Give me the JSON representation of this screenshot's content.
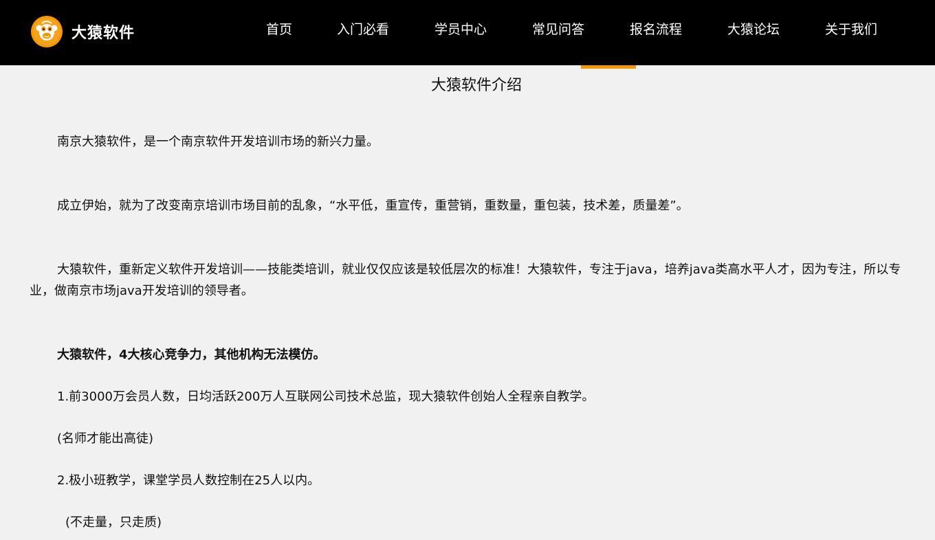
{
  "header": {
    "brand": "大猿软件",
    "logo_icon": "monkey-logo-icon",
    "accent_color": "#f39800",
    "nav": [
      {
        "label": "首页",
        "active": false
      },
      {
        "label": "入门必看",
        "active": false
      },
      {
        "label": "学员中心",
        "active": false
      },
      {
        "label": "常见问答",
        "active": false
      },
      {
        "label": "报名流程",
        "active": false
      },
      {
        "label": "大猿论坛",
        "active": false
      },
      {
        "label": "关于我们",
        "active": true
      }
    ]
  },
  "main": {
    "title": "大猿软件介绍",
    "paragraphs": [
      "南京大猿软件，是一个南京软件开发培训市场的新兴力量。",
      "成立伊始，就为了改变南京培训市场目前的乱象，“水平低，重宣传，重营销，重数量，重包装，技术差，质量差”。",
      "大猿软件，重新定义软件开发培训——技能类培训，就业仅仅应该是较低层次的标准！大猿软件，专注于java，培养java类高水平人才，因为专注，所以专业，做南京市场java开发培训的领导者。",
      "大猿软件，4大核心竞争力，其他机构无法模仿。",
      "1.前3000万会员人数，日均活跃200万人互联网公司技术总监，现大猿软件创始人全程亲自教学。",
      "(名师才能出高徒)",
      "2.极小班教学，课堂学员人数控制在25人以内。",
      "(不走量，只走质)"
    ]
  }
}
